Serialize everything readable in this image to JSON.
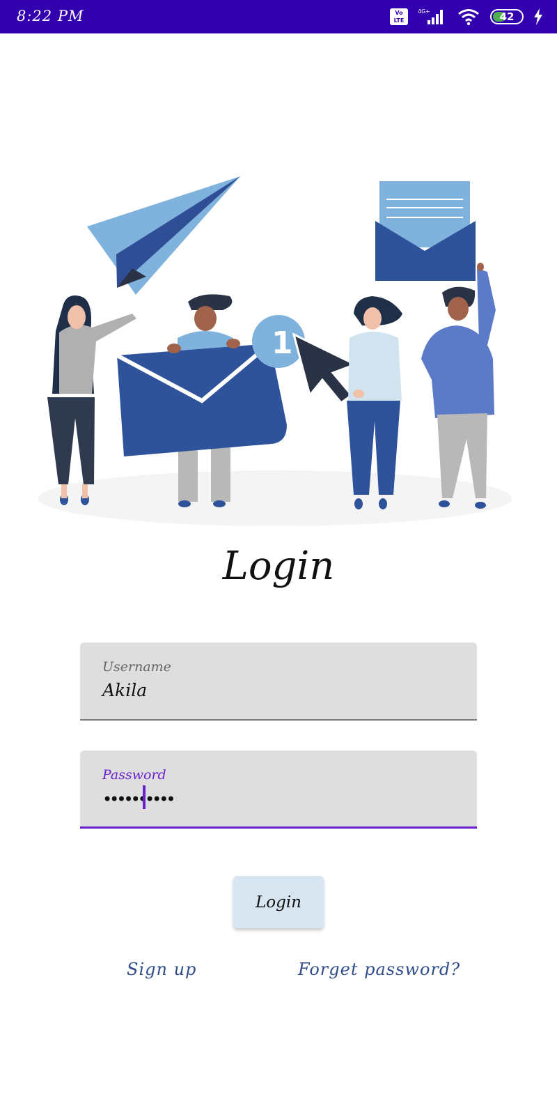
{
  "status_bar": {
    "time": "8:22 PM",
    "volte_label": "Vo LTE",
    "network_label": "4G+",
    "battery_level": "42"
  },
  "illustration": {
    "badge_number": "1"
  },
  "login_form": {
    "title": "Login",
    "username": {
      "label": "Username",
      "value": "Akila"
    },
    "password": {
      "label": "Password",
      "masked_value": "••••••••••"
    },
    "login_button_label": "Login",
    "signup_link": "Sign up",
    "forget_password_link": "Forget password?"
  },
  "colors": {
    "status_bar": "#3300b0",
    "accent": "#6a1fd0",
    "button_bg": "#d7e6f0",
    "link": "#2f4d8a"
  }
}
